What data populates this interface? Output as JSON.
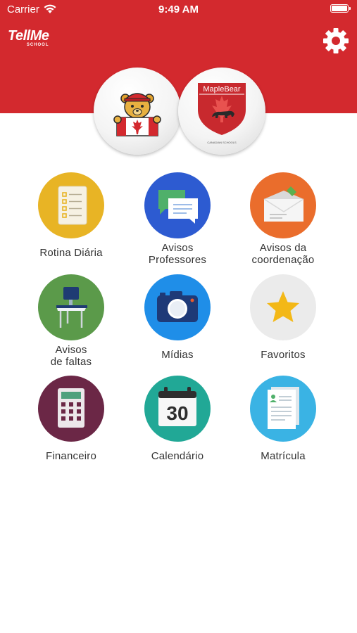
{
  "status_bar": {
    "carrier": "Carrier",
    "time": "9:49 AM"
  },
  "header": {
    "logo_main": "TellMe",
    "logo_sub": "SCHOOL",
    "background_color": "#d3292e",
    "settings_icon": "gear-icon"
  },
  "schools": {
    "left_logo": "maple-bear-mascot",
    "right_logo_text": "MapleBear",
    "right_logo_caption": "CANADIAN SCHOOLS"
  },
  "menu": [
    {
      "label": "Rotina Diária",
      "icon": "checklist-icon",
      "color": "#e8b425"
    },
    {
      "label": "Avisos\nProfessores",
      "icon": "chat-bubbles-icon",
      "color": "#2d5bd1"
    },
    {
      "label": "Avisos da\ncoordenação",
      "icon": "envelope-icon",
      "color": "#ea6d2c"
    },
    {
      "label": "Avisos\nde faltas",
      "icon": "school-desk-icon",
      "color": "#5b9a4a"
    },
    {
      "label": "Mídias",
      "icon": "camera-icon",
      "color": "#1f8ee8"
    },
    {
      "label": "Favoritos",
      "icon": "star-icon",
      "color": "#ebebeb"
    },
    {
      "label": "Financeiro",
      "icon": "calculator-icon",
      "color": "#6b2746"
    },
    {
      "label": "Calendário",
      "icon": "calendar-icon",
      "color": "#21a896"
    },
    {
      "label": "Matrícula",
      "icon": "enrollment-form-icon",
      "color": "#3ab3e4"
    }
  ],
  "calendar_day": "30"
}
